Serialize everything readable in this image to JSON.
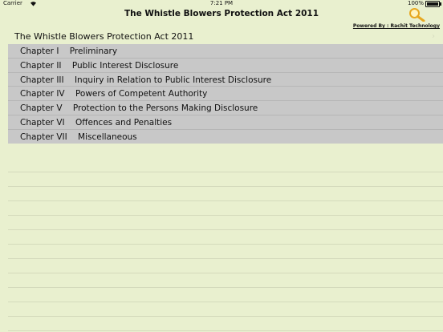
{
  "status_bar": {
    "carrier": "Carrier",
    "time": "7:21 PM",
    "battery": "100%"
  },
  "nav": {
    "title": "The Whistle Blowers Protection Act 2011",
    "search_icon": "magnifier-icon",
    "powered_by": "Powered By : Rachit Technology"
  },
  "act_title": "The Whistle Blowers Protection Act 2011",
  "chapters": [
    {
      "label": "Chapter I    Preliminary"
    },
    {
      "label": "Chapter II    Public Interest Disclosure"
    },
    {
      "label": "Chapter III    Inquiry in Relation to Public Interest Disclosure"
    },
    {
      "label": "Chapter IV    Powers of Competent Authority"
    },
    {
      "label": "Chapter V    Protection to the Persons Making Disclosure"
    },
    {
      "label": "Chapter VI    Offences and Penalties"
    },
    {
      "label": "Chapter VII    Miscellaneous"
    }
  ],
  "colors": {
    "background": "#e9f0cf",
    "list_background": "#c8c8c8",
    "search_icon": "#e7a820"
  }
}
